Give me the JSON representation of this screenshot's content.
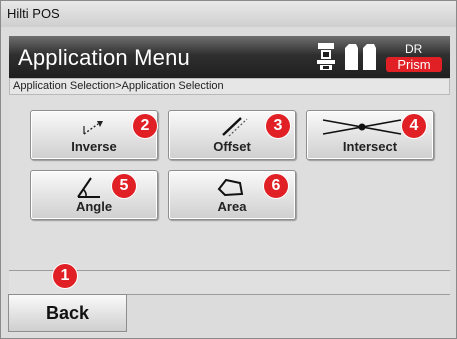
{
  "window": {
    "title": "Hilti POS"
  },
  "header": {
    "title": "Application Menu",
    "icons": [
      "total-station-icon",
      "prism-pair-icon"
    ],
    "target_top": "DR",
    "target_mode": "Prism",
    "accent_color": "#e02025"
  },
  "breadcrumb": "Application Selection>Application Selection",
  "apps": [
    {
      "label": "Inverse",
      "icon": "inverse-icon",
      "badge": "2"
    },
    {
      "label": "Offset",
      "icon": "offset-icon",
      "badge": "3"
    },
    {
      "label": "Intersect",
      "icon": "intersect-icon",
      "badge": "4"
    },
    {
      "label": "Angle",
      "icon": "angle-icon",
      "badge": "5"
    },
    {
      "label": "Area",
      "icon": "area-icon",
      "badge": "6"
    }
  ],
  "back": {
    "label": "Back",
    "badge": "1"
  }
}
